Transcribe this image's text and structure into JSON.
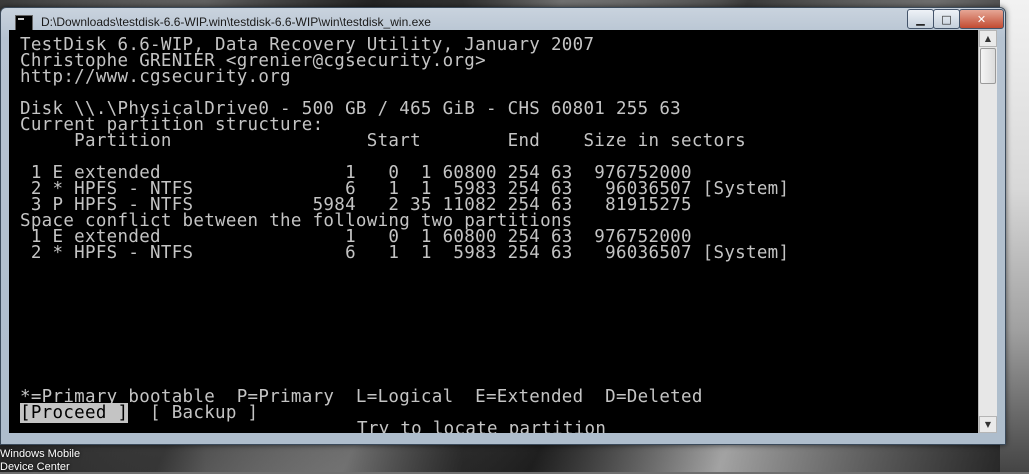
{
  "window": {
    "title": "D:\\Downloads\\testdisk-6.6-WIP.win\\testdisk-6.6-WIP\\win\\testdisk_win.exe",
    "minimize_glyph": "▁",
    "maximize_glyph": "□",
    "close_glyph": "✕"
  },
  "console": {
    "lines": [
      "TestDisk 6.6-WIP, Data Recovery Utility, January 2007",
      "Christophe GRENIER <grenier@cgsecurity.org>",
      "http://www.cgsecurity.org",
      "",
      "Disk \\\\.\\PhysicalDrive0 - 500 GB / 465 GiB - CHS 60801 255 63",
      "Current partition structure:",
      "     Partition                  Start        End    Size in sectors",
      "",
      " 1 E extended                 1   0  1 60800 254 63  976752000",
      " 2 * HPFS - NTFS              6   1  1  5983 254 63   96036507 [System]",
      " 3 P HPFS - NTFS           5984   2 35 11082 254 63   81915275",
      "Space conflict between the following two partitions",
      " 1 E extended                 1   0  1 60800 254 63  976752000",
      " 2 * HPFS - NTFS              6   1  1  5983 254 63   96036507 [System]"
    ],
    "legend": "*=Primary bootable  P=Primary  L=Logical  E=Extended  D=Deleted",
    "proceed_label": "[Proceed ]",
    "backup_label": "[ Backup ]",
    "status": "Try to locate partition"
  },
  "desktop": {
    "label": "Windows Mobile Device Center"
  },
  "colors": {
    "console_bg": "#000000",
    "console_fg": "#c4c4c4"
  }
}
